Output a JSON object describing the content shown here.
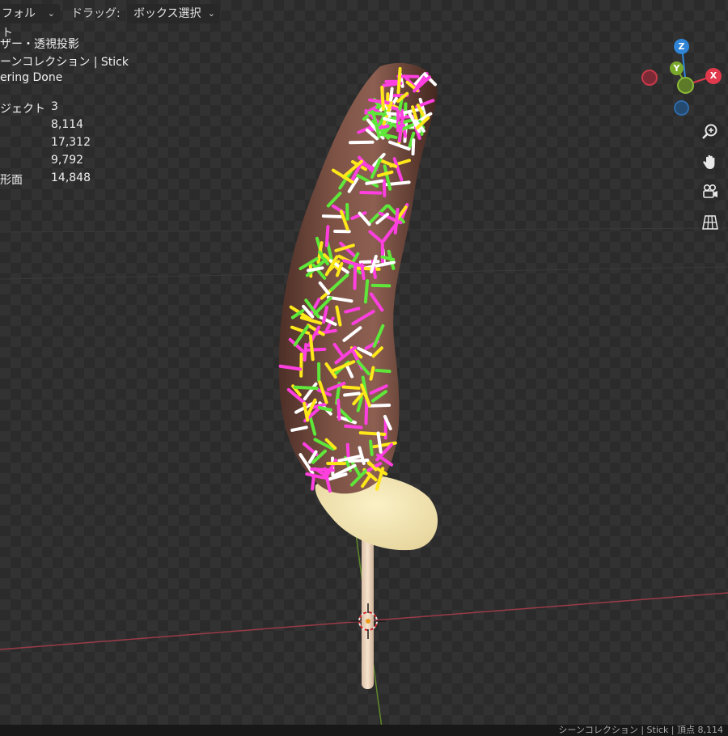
{
  "header": {
    "mode_dropdown": "フォルト",
    "drag_label": "ドラッグ:",
    "drag_dropdown": "ボックス選択"
  },
  "viewport_overlay": {
    "view_name": "ザー・透視投影",
    "collection": "ーンコレクション | Stick",
    "status": "ering Done",
    "stats": [
      {
        "label": "ジェクト",
        "value": "3"
      },
      {
        "label": "",
        "value": "8,114"
      },
      {
        "label": "",
        "value": "17,312"
      },
      {
        "label": "",
        "value": "9,792"
      },
      {
        "label": "形面",
        "value": "14,848"
      }
    ]
  },
  "gizmo": {
    "z_label": "Z",
    "y_label": "Y",
    "x_label": "X",
    "colors": {
      "x": "#e0394b",
      "y": "#7aa82a",
      "z": "#2f84d6"
    }
  },
  "nav_buttons": [
    {
      "icon": "zoom-icon"
    },
    {
      "icon": "hand-pan-icon"
    },
    {
      "icon": "camera-icon"
    },
    {
      "icon": "grid-perspective-icon"
    }
  ],
  "statusbar": {
    "text": "シーンコレクション | Stick | 頂点 8,114"
  },
  "scene_colors": {
    "chocolate": "#7a4f43",
    "banana": "#f2e3b0",
    "stick": "#f0d8bf",
    "sprinkles": [
      "#ff3fe0",
      "#ffe81a",
      "#5fe83a",
      "#ffffff"
    ]
  }
}
